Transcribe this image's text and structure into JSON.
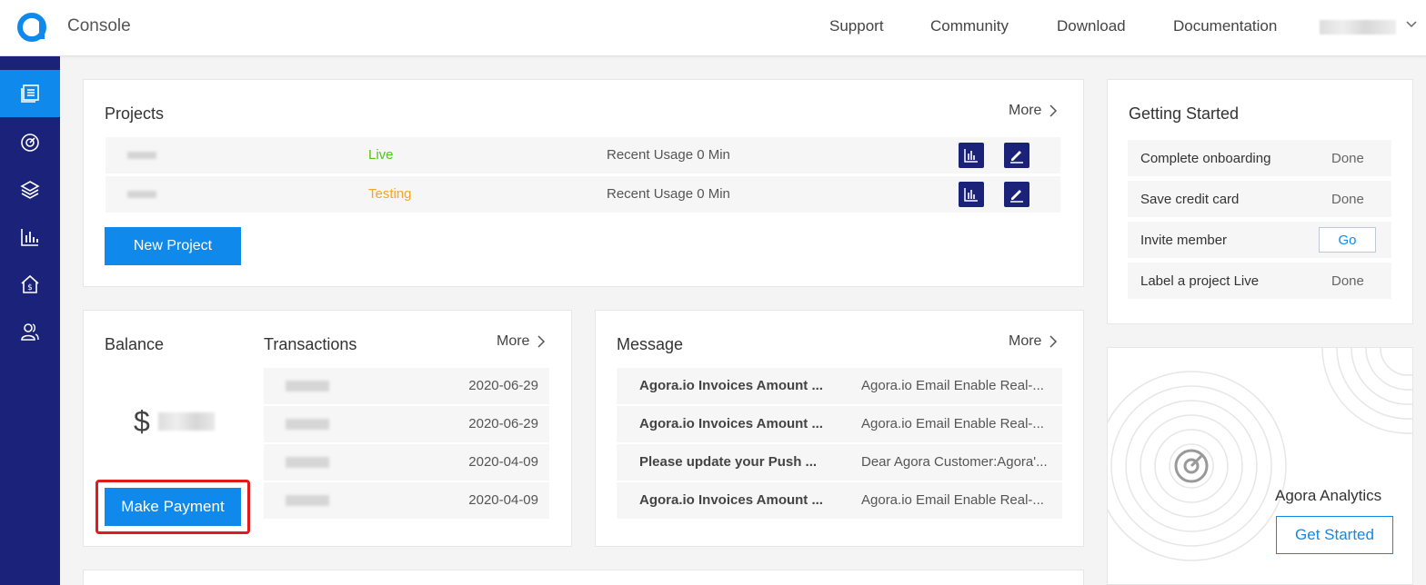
{
  "header": {
    "app_title": "Console",
    "nav": [
      "Support",
      "Community",
      "Download",
      "Documentation"
    ]
  },
  "sidebar": {
    "items": [
      {
        "name": "projects",
        "icon": "projects-icon",
        "active": true
      },
      {
        "name": "usage",
        "icon": "gauge-icon",
        "active": false
      },
      {
        "name": "products",
        "icon": "layers-icon",
        "active": false
      },
      {
        "name": "analytics",
        "icon": "bar-chart-icon",
        "active": false
      },
      {
        "name": "billing",
        "icon": "finance-house-icon",
        "active": false
      },
      {
        "name": "members",
        "icon": "members-icon",
        "active": false
      }
    ]
  },
  "projects": {
    "title": "Projects",
    "more_label": "More",
    "rows": [
      {
        "status": "Live",
        "status_color": "#52c41a",
        "usage": "Recent Usage 0 Min"
      },
      {
        "status": "Testing",
        "status_color": "#f5a623",
        "usage": "Recent Usage 0 Min"
      }
    ],
    "new_button": "New Project"
  },
  "getting_started": {
    "title": "Getting Started",
    "steps": [
      {
        "label": "Complete onboarding",
        "state": "Done"
      },
      {
        "label": "Save credit card",
        "state": "Done"
      },
      {
        "label": "Invite member",
        "action": "Go"
      },
      {
        "label": "Label a project Live",
        "state": "Done"
      }
    ]
  },
  "balance": {
    "title": "Balance",
    "currency": "$",
    "pay_button": "Make Payment"
  },
  "transactions": {
    "title": "Transactions",
    "more_label": "More",
    "dates": [
      "2020-06-29",
      "2020-06-29",
      "2020-04-09",
      "2020-04-09"
    ]
  },
  "message": {
    "title": "Message",
    "more_label": "More",
    "rows": [
      {
        "subject": "Agora.io Invoices Amount ...",
        "preview": "Agora.io Email Enable Real-..."
      },
      {
        "subject": "Agora.io Invoices Amount ...",
        "preview": "Agora.io Email Enable Real-..."
      },
      {
        "subject": "Please update your Push ...",
        "preview": "Dear Agora Customer:Agora'..."
      },
      {
        "subject": "Agora.io Invoices Amount ...",
        "preview": "Agora.io Email Enable Real-..."
      }
    ]
  },
  "analytics": {
    "title": "Agora Analytics",
    "button": "Get Started"
  },
  "colors": {
    "accent": "#0f8aec",
    "sidebar": "#1a2379",
    "highlight": "#e01b1b"
  }
}
